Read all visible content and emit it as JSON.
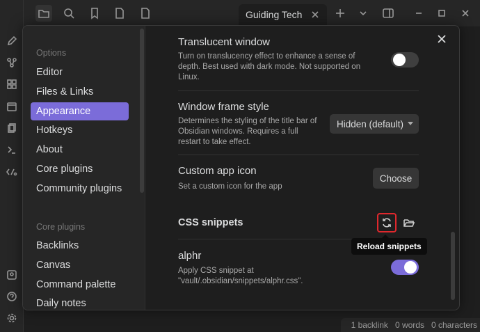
{
  "workspace": {
    "tab_title": "Guiding Tech",
    "status": {
      "backlinks": "1 backlink",
      "words": "0 words",
      "characters": "0 characters"
    }
  },
  "settings": {
    "sidebar": {
      "options_heading": "Options",
      "options": [
        "Editor",
        "Files & Links",
        "Appearance",
        "Hotkeys",
        "About",
        "Core plugins",
        "Community plugins"
      ],
      "active_item": "Appearance",
      "core_heading": "Core plugins",
      "core_plugins": [
        "Backlinks",
        "Canvas",
        "Command palette",
        "Daily notes"
      ]
    },
    "translucent": {
      "name": "Translucent window",
      "desc": "Turn on translucency effect to enhance a sense of depth. Best used with dark mode. Not supported on Linux.",
      "enabled": false
    },
    "frame": {
      "name": "Window frame style",
      "desc": "Determines the styling of the title bar of Obsidian windows. Requires a full restart to take effect.",
      "value": "Hidden (default)"
    },
    "app_icon": {
      "name": "Custom app icon",
      "desc": "Set a custom icon for the app",
      "button": "Choose"
    },
    "snippets": {
      "name": "CSS snippets",
      "tooltip": "Reload snippets"
    },
    "alphr": {
      "name": "alphr",
      "desc": "Apply CSS snippet at \"vault/.obsidian/snippets/alphr.css\".",
      "enabled": true
    }
  },
  "colors": {
    "accent": "#7b6cd9",
    "highlight_border": "#e0282d",
    "background": "#1e1e1e",
    "panel": "#262626"
  }
}
